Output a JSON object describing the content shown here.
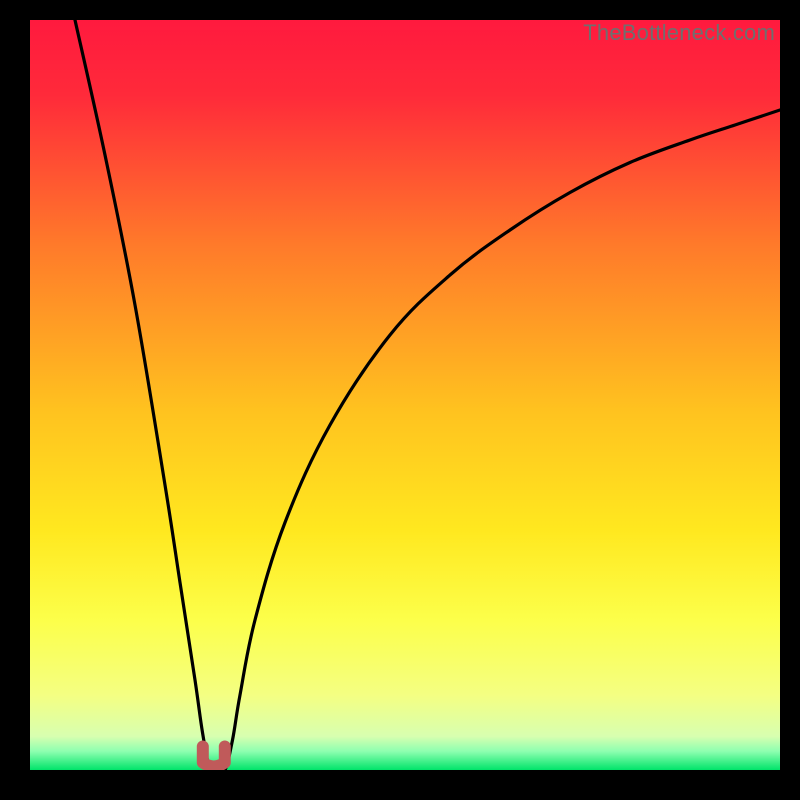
{
  "watermark": {
    "text": "TheBottleneck.com"
  },
  "chart_data": {
    "type": "line",
    "title": "",
    "xlabel": "",
    "ylabel": "",
    "xlim": [
      0,
      100
    ],
    "ylim": [
      0,
      100
    ],
    "grid": false,
    "legend": false,
    "colors": {
      "gradient_top": "#ff1a3e",
      "gradient_mid_upper": "#ff7a2a",
      "gradient_mid": "#ffd21f",
      "gradient_mid_lower": "#fff83c",
      "gradient_near_bottom": "#f4ff82",
      "gradient_bottom": "#00e46a",
      "curve": "#000000",
      "marker": "#c05a5a"
    },
    "series": [
      {
        "name": "bottleneck-curve",
        "description": "V-shaped bottleneck percentage curve. Plunges from ~100 at x≈6 to 0 at x≈24, stays near 0 for a short span, then rises asymptotically toward ~90 at x=100.",
        "x": [
          6,
          10,
          14,
          18,
          20,
          22,
          23,
          24,
          25,
          26,
          27,
          28,
          30,
          34,
          40,
          48,
          56,
          64,
          72,
          80,
          88,
          94,
          100
        ],
        "values": [
          100,
          82,
          62,
          38,
          25,
          12,
          5,
          0,
          0,
          0,
          4,
          10,
          20,
          33,
          46,
          58,
          66,
          72,
          77,
          81,
          84,
          86,
          88
        ]
      }
    ],
    "markers": [
      {
        "name": "optimal-point",
        "shape": "u",
        "x": 24.5,
        "y": 1,
        "color": "#c05a5a"
      }
    ]
  }
}
